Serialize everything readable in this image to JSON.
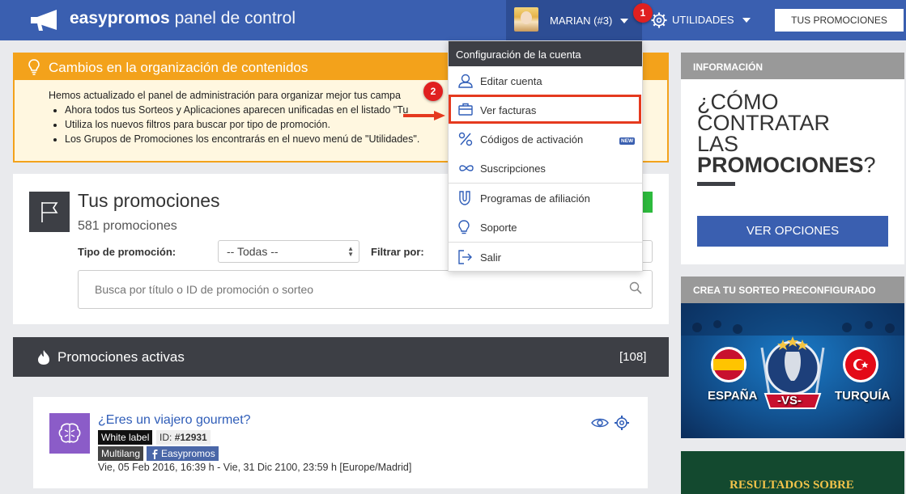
{
  "header": {
    "brand_bold": "easypromos",
    "brand_rest": " panel de control",
    "user_label": "MARIAN (#3)",
    "utilities_label": "UTILIDADES",
    "my_promos_button": "TUS PROMOCIONES"
  },
  "steps": {
    "step1": "1",
    "step2": "2"
  },
  "alert": {
    "title": "Cambios en la organización de contenidos",
    "intro": "Hemos actualizado el panel de administración para organizar mejor tus campa",
    "items": [
      "Ahora todos tus Sorteos y Aplicaciones aparecen unificadas en el listado \"Tu",
      "Utiliza los nuevos filtros para buscar por tipo de promoción.",
      "Los Grupos de Promociones los encontrarás en el nuevo menú de \"Utilidades\"."
    ]
  },
  "promotions": {
    "title": "Tus promociones",
    "count": "581 promociones",
    "type_label": "Tipo de promoción:",
    "type_value": "-- Todas --",
    "filter_label": "Filtrar por:",
    "search_placeholder": "Busca por título o ID de promoción o sorteo"
  },
  "active": {
    "title": "Promociones activas",
    "count": "[108]",
    "card": {
      "title": "¿Eres un viajero gourmet?",
      "tag_white_label": "White label",
      "id_prefix": "ID:",
      "id_value": "#12931",
      "tag_multilang": "Multilang",
      "tag_facebook": "Easypromos",
      "dates": "Vie, 05 Feb 2016, 16:39 h - Vie, 31 Dic 2100, 23:59 h [Europe/Madrid]"
    }
  },
  "dropdown": {
    "header": "Configuración de la cuenta",
    "items": [
      {
        "label": "Editar cuenta",
        "icon": "user-icon"
      },
      {
        "label": "Ver facturas",
        "icon": "briefcase-icon"
      },
      {
        "label": "Códigos de activación",
        "icon": "percent-icon",
        "badge": "NEW"
      },
      {
        "label": "Suscripciones",
        "icon": "infinity-icon"
      },
      {
        "label": "Programas de afiliación",
        "icon": "magnet-icon"
      },
      {
        "label": "Soporte",
        "icon": "lightbulb-icon"
      },
      {
        "label": "Salir",
        "icon": "logout-icon"
      }
    ]
  },
  "info": {
    "header": "INFORMACIÓN",
    "line1": "¿CÓMO",
    "line2": "CONTRATAR",
    "line3": "LAS",
    "line4_bold": "PROMOCIONES",
    "line4_rest": "?",
    "button": "VER OPCIONES"
  },
  "crea": {
    "header": "CREA TU SORTEO PRECONFIGURADO",
    "team_left": "ESPAÑA",
    "vs": "-VS-",
    "team_right": "TURQUÍA"
  },
  "results": {
    "text": "RESULTADOS SOBRE"
  },
  "colors": {
    "brand": "#3a5fb0",
    "dark": "#3d3f45",
    "alert": "#f3a21b",
    "highlight": "#e53a1f"
  }
}
